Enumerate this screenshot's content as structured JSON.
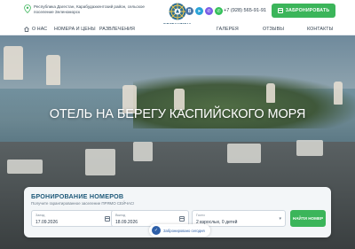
{
  "header": {
    "address": "Республика Дагестан, Карабудахкентский район, сельское поселение Зеленоморск",
    "logo": {
      "name": "БРИГАНТИНА",
      "sub": "ОТЕЛЬ"
    },
    "socials": [
      {
        "icon": "vk-icon",
        "glyph": "B"
      },
      {
        "icon": "telegram-icon",
        "glyph": "➤"
      },
      {
        "icon": "viber-icon",
        "glyph": "✆"
      },
      {
        "icon": "whatsapp-icon",
        "glyph": "✆"
      }
    ],
    "phone": "+7 (928) 565-91-91",
    "book_label": "ЗАБРОНИРОВАТЬ"
  },
  "nav": {
    "items": [
      "О НАС",
      "НОМЕРА И ЦЕНЫ",
      "РАЗВЛЕЧЕНИЯ",
      "ГАЛЕРЕЯ",
      "ОТЗЫВЫ",
      "КОНТАКТЫ"
    ]
  },
  "hero": {
    "title": "ОТЕЛЬ НА БЕРЕГУ КАСПИЙСКОГО МОРЯ"
  },
  "booking": {
    "title": "БРОНИРОВАНИЕ НОМЕРОВ",
    "subtitle": "Получите гарантированное заселение ПРЯМО СЕЙЧАС!",
    "checkin": {
      "label": "Заезд",
      "value": "17.09.2026"
    },
    "checkout": {
      "label": "Выезд",
      "value": "18.09.2026"
    },
    "guests": {
      "label": "Гости",
      "value": "2 взрослых, 0 детей"
    },
    "find_label": "НАЙТИ НОМЕР",
    "booked_badge": "Забронировано сегодня"
  },
  "colors": {
    "accent": "#3bb55a",
    "brand": "#1f5a7a"
  }
}
